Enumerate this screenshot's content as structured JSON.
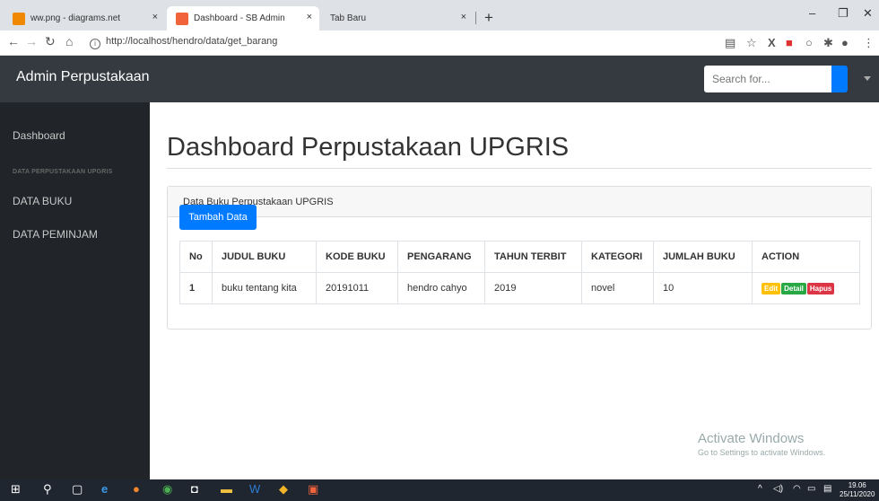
{
  "browser": {
    "tabs": [
      {
        "label": "ww.png - diagrams.net",
        "icon": "diagrams-icon",
        "color": "#f08705"
      },
      {
        "label": "Dashboard - SB Admin",
        "icon": "page-icon",
        "color": "#f0633b"
      },
      {
        "label": "Tab Baru",
        "icon": "",
        "color": ""
      }
    ],
    "close_glyph": "×",
    "new_tab_glyph": "+",
    "url": "http://localhost/hendro/data/get_barang",
    "win_minimize": "–",
    "win_restore": "❐",
    "win_close": "✕"
  },
  "app": {
    "brand": "Admin Perpustakaan",
    "search_placeholder": "Search for...",
    "accent": "#007bff"
  },
  "sidebar": {
    "dashboard": "Dashboard",
    "section": "DATA PERPUSTAKAAN UPGRIS",
    "items": [
      "DATA BUKU",
      "DATA PEMINJAM"
    ]
  },
  "main": {
    "title": "Dashboard Perpustakaan UPGRIS",
    "card_title": "Data Buku Perpustakaan UPGRIS",
    "add_button": "Tambah Data",
    "columns": [
      "No",
      "JUDUL BUKU",
      "KODE BUKU",
      "PENGARANG",
      "TAHUN TERBIT",
      "KATEGORI",
      "JUMLAH BUKU",
      "ACTION"
    ],
    "rows": [
      {
        "no": "1",
        "judul": "buku tentang kita",
        "kode": "20191011",
        "pengarang": "hendro cahyo",
        "tahun": "2019",
        "kategori": "novel",
        "jumlah": "10"
      }
    ],
    "actions": {
      "edit": "Edit",
      "detail": "Detail",
      "hapus": "Hapus"
    }
  },
  "watermark": {
    "line1": "Activate Windows",
    "line2": "Go to Settings to activate Windows."
  },
  "taskbar": {
    "time": "19.06",
    "date": "25/11/2020"
  }
}
